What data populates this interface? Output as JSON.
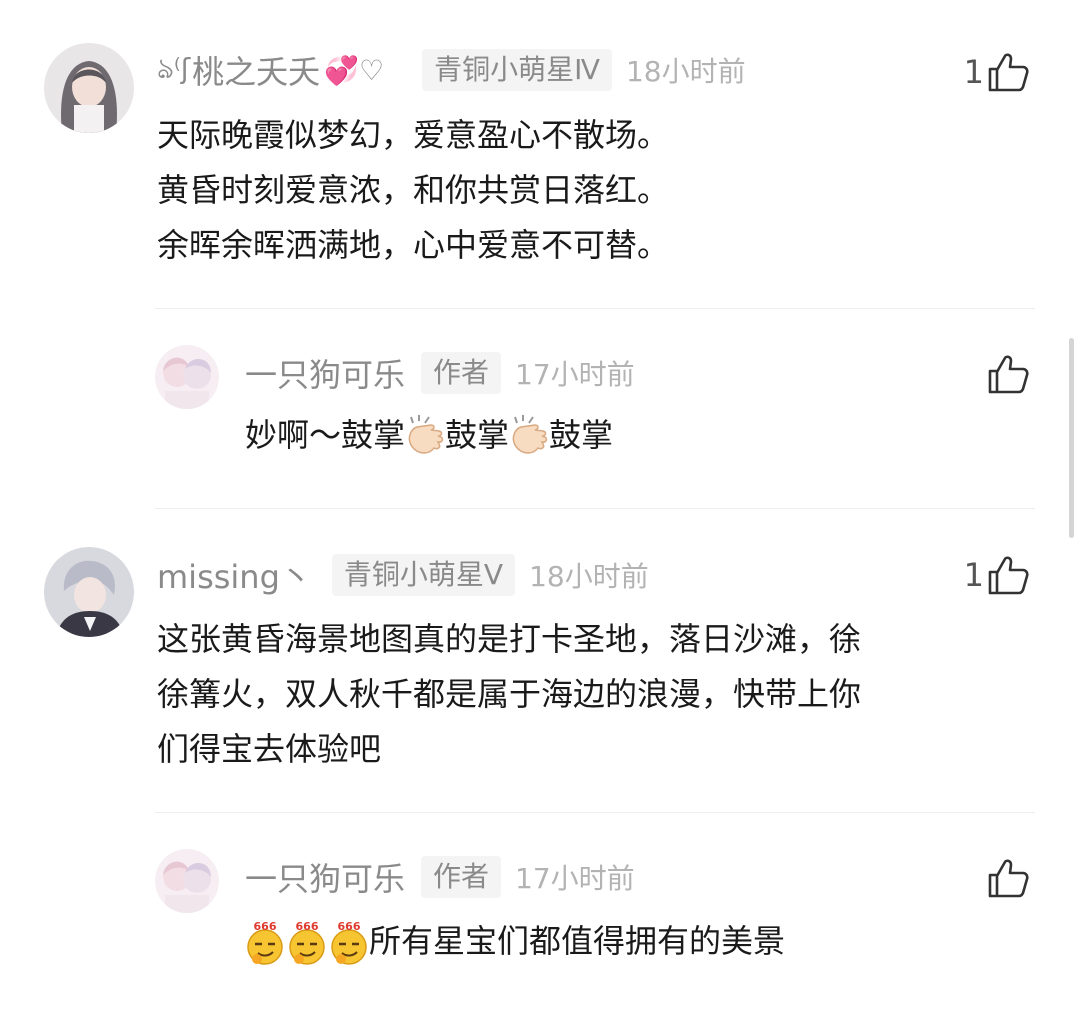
{
  "comments": [
    {
      "username": "桃之夭夭",
      "name_deco_left": "ঌ⁽ʃ",
      "name_deco_right": "💞♡",
      "badge": "青铜小萌星Ⅳ",
      "time": "18小时前",
      "likes": "1",
      "lines": [
        "天际晚霞似梦幻，爱意盈心不散场。",
        "黄昏时刻爱意浓，和你共赏日落红。",
        "余晖余晖洒满地，心中爱意不可替。"
      ]
    },
    {
      "username": "一只狗可乐",
      "badge": "作者",
      "time": "17小时前",
      "likes": "",
      "text_parts": [
        "妙啊～鼓掌",
        "鼓掌",
        "鼓掌"
      ]
    },
    {
      "username": "missing丶",
      "badge": "青铜小萌星Ⅴ",
      "time": "18小时前",
      "likes": "1",
      "lines": [
        "这张黄昏海景地图真的是打卡圣地，落日沙滩，徐",
        "徐篝火，双人秋千都是属于海边的浪漫，快带上你",
        "们得宝去体验吧"
      ]
    },
    {
      "username": "一只狗可乐",
      "badge": "作者",
      "time": "17小时前",
      "likes": "",
      "text": "所有星宝们都值得拥有的美景",
      "emoji_label": "666"
    }
  ]
}
